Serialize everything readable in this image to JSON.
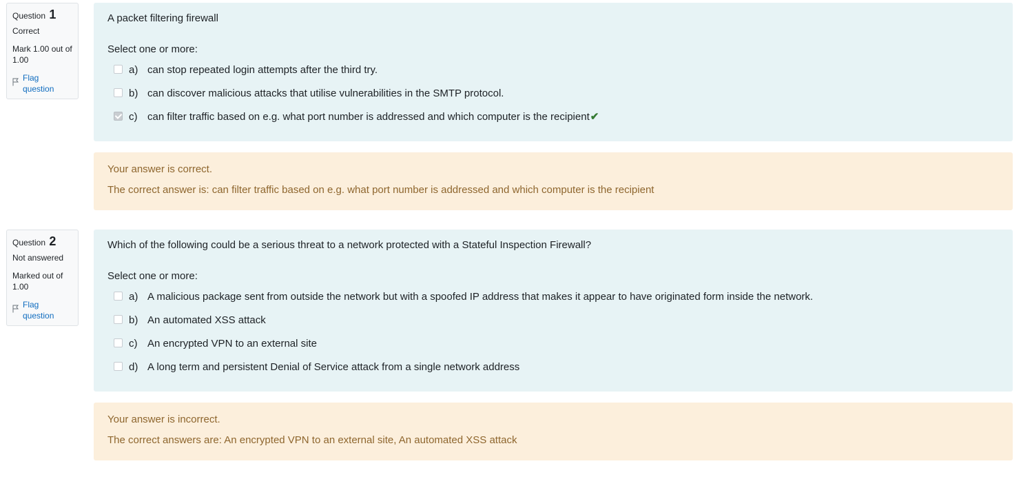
{
  "questions": [
    {
      "number_label": "Question",
      "number": "1",
      "state": "Correct",
      "grade": "Mark 1.00 out of 1.00",
      "flag_label": "Flag question",
      "question_text": "A packet filtering firewall",
      "prompt": "Select one or more:",
      "answers": [
        {
          "letter": "a)",
          "text": "can stop repeated login attempts after the third try.",
          "checked": false
        },
        {
          "letter": "b)",
          "text": "can discover malicious attacks that utilise vulnerabilities in the SMTP protocol.",
          "checked": false
        },
        {
          "letter": "c)",
          "text": "can filter traffic based on e.g. what port number is addressed and which computer is the recipient",
          "checked": true,
          "correct_mark": "✔"
        }
      ],
      "feedback": "Your answer is correct.",
      "right_answer": "The correct answer is: can filter traffic based on e.g. what port number is addressed and which computer is the recipient"
    },
    {
      "number_label": "Question",
      "number": "2",
      "state": "Not answered",
      "grade": "Marked out of 1.00",
      "flag_label": "Flag question",
      "question_text": "Which of the following could be a serious threat to a network protected with a Stateful Inspection Firewall?",
      "prompt": "Select one or more:",
      "answers": [
        {
          "letter": "a)",
          "text": "A malicious package sent from outside the network but with a spoofed IP address that makes it appear to have originated form inside the network.",
          "checked": false
        },
        {
          "letter": "b)",
          "text": "An automated XSS attack",
          "checked": false
        },
        {
          "letter": "c)",
          "text": "An encrypted VPN to an external site",
          "checked": false
        },
        {
          "letter": "d)",
          "text": "A long term and persistent Denial of Service attack from a single network address",
          "checked": false
        }
      ],
      "feedback": "Your answer is incorrect.",
      "right_answer": "The correct answers are: An encrypted VPN to an external site, An automated XSS attack"
    }
  ],
  "colors": {
    "formulation_bg": "#e7f3f5",
    "outcome_bg": "#fcefdc",
    "outcome_text": "#8e662e",
    "link": "#0f6cbf",
    "correct_tick": "#357a32"
  },
  "icons": {
    "flag": "flag-icon",
    "tick": "check-icon"
  }
}
